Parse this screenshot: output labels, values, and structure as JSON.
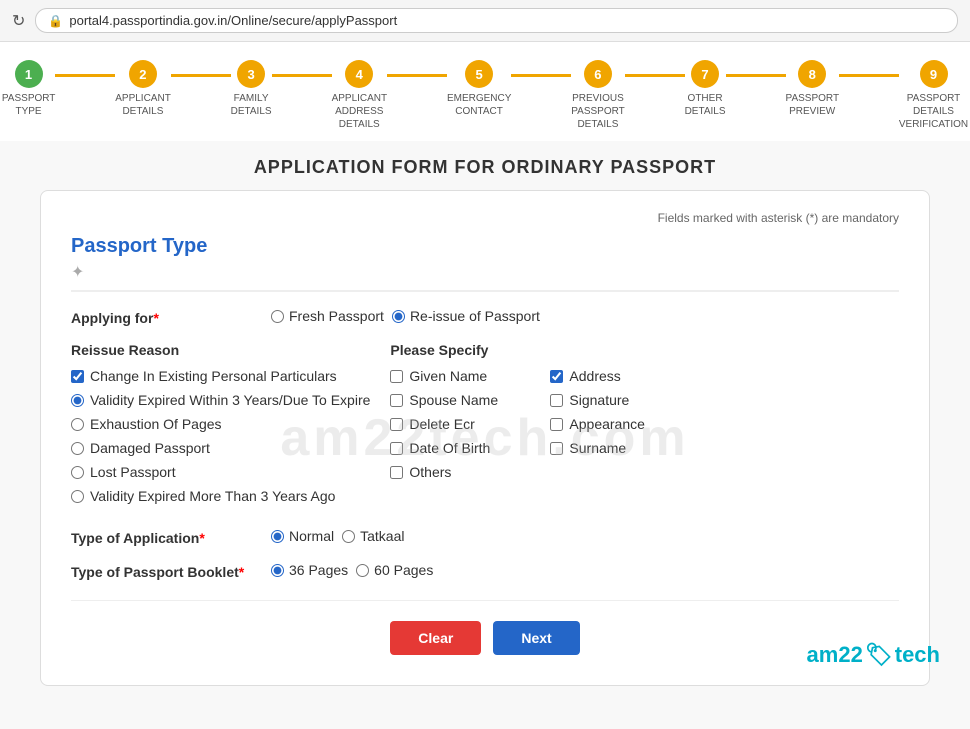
{
  "browser": {
    "url": "portal4.passportindia.gov.in/Online/secure/applyPassport",
    "refresh_icon": "↻",
    "lock_icon": "🔒"
  },
  "steps": [
    {
      "number": "1",
      "label": "PASSPORT TYPE",
      "state": "active"
    },
    {
      "number": "2",
      "label": "APPLICANT DETAILS",
      "state": "pending"
    },
    {
      "number": "3",
      "label": "FAMILY DETAILS",
      "state": "pending"
    },
    {
      "number": "4",
      "label": "APPLICANT ADDRESS DETAILS",
      "state": "pending"
    },
    {
      "number": "5",
      "label": "EMERGENCY CONTACT",
      "state": "pending"
    },
    {
      "number": "6",
      "label": "PREVIOUS PASSPORT DETAILS",
      "state": "pending"
    },
    {
      "number": "7",
      "label": "OTHER DETAILS",
      "state": "pending"
    },
    {
      "number": "8",
      "label": "PASSPORT PREVIEW",
      "state": "pending"
    },
    {
      "number": "9",
      "label": "PASSPORT DETAILS VERIFICATION",
      "state": "pending"
    }
  ],
  "form": {
    "title": "APPLICATION FORM FOR ORDINARY PASSPORT",
    "mandatory_note": "Fields marked with asterisk (*) are mandatory",
    "section_title": "Passport Type",
    "applying_for": {
      "label": "Applying for",
      "required": true,
      "options": [
        {
          "value": "fresh",
          "label": "Fresh Passport",
          "checked": false
        },
        {
          "value": "reissue",
          "label": "Re-issue of Passport",
          "checked": true
        }
      ]
    },
    "reissue_reason": {
      "label": "Reissue Reason",
      "items": [
        {
          "label": "Change In Existing Personal Particulars",
          "checked": true,
          "type": "checkbox"
        },
        {
          "label": "Validity Expired Within 3 Years/Due To Expire",
          "checked": true,
          "type": "radio"
        },
        {
          "label": "Exhaustion Of Pages",
          "checked": false,
          "type": "radio"
        },
        {
          "label": "Damaged Passport",
          "checked": false,
          "type": "radio"
        },
        {
          "label": "Lost Passport",
          "checked": false,
          "type": "radio"
        },
        {
          "label": "Validity Expired More Than 3 Years Ago",
          "checked": false,
          "type": "radio"
        }
      ]
    },
    "please_specify": {
      "label": "Please Specify",
      "col1": [
        {
          "label": "Given Name",
          "checked": false
        },
        {
          "label": "Spouse Name",
          "checked": false
        },
        {
          "label": "Delete Ecr",
          "checked": false
        },
        {
          "label": "Date Of Birth",
          "checked": false
        },
        {
          "label": "Others",
          "checked": false
        }
      ],
      "col2": [
        {
          "label": "Address",
          "checked": true
        },
        {
          "label": "Signature",
          "checked": false
        },
        {
          "label": "Appearance",
          "checked": false
        },
        {
          "label": "Surname",
          "checked": false
        }
      ]
    },
    "type_of_application": {
      "label": "Type of Application",
      "required": true,
      "options": [
        {
          "value": "normal",
          "label": "Normal",
          "checked": true
        },
        {
          "value": "tatkaal",
          "label": "Tatkaal",
          "checked": false
        }
      ]
    },
    "type_of_passport_booklet": {
      "label": "Type of Passport Booklet",
      "required": true,
      "options": [
        {
          "value": "36",
          "label": "36 Pages",
          "checked": true
        },
        {
          "value": "60",
          "label": "60 Pages",
          "checked": false
        }
      ]
    },
    "buttons": {
      "clear": "Clear",
      "next": "Next"
    }
  },
  "watermark": "am22tech.com",
  "brand": {
    "text_left": "am22",
    "emoji": "🏷",
    "text_right": "tech"
  }
}
